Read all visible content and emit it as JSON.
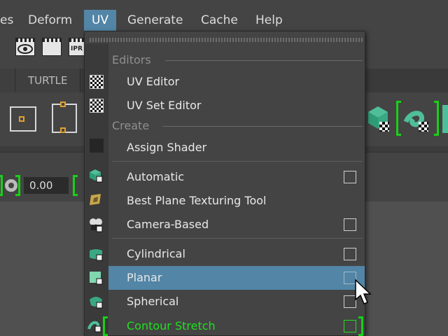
{
  "menubar": {
    "items": [
      {
        "label": "es"
      },
      {
        "label": "Deform"
      },
      {
        "label": "UV"
      },
      {
        "label": "Generate"
      },
      {
        "label": "Cache"
      },
      {
        "label": "Help"
      }
    ],
    "active": "UV"
  },
  "shelf": {
    "icons": [
      "eye-icon",
      "clapper-icon",
      "ipr-icon"
    ],
    "ipr_label": "IPR"
  },
  "tabs": {
    "turtle": "TURTLE"
  },
  "field": {
    "value": "0.00"
  },
  "menu": {
    "sections": {
      "editors": "Editors",
      "create": "Create"
    },
    "items": [
      {
        "label": "UV Editor",
        "icon": "uv-editor-icon"
      },
      {
        "label": "UV Set Editor",
        "icon": "uv-set-editor-icon"
      },
      {
        "label": "Assign Shader",
        "icon": "shader-swatch-icon"
      },
      {
        "label": "Automatic",
        "icon": "automatic-mapping-icon",
        "has_option": true
      },
      {
        "label": "Best Plane Texturing Tool",
        "icon": "best-plane-icon"
      },
      {
        "label": "Camera-Based",
        "icon": "camera-based-icon",
        "has_option": true
      },
      {
        "label": "Cylindrical",
        "icon": "cylindrical-mapping-icon",
        "has_option": true
      },
      {
        "label": "Planar",
        "icon": "planar-mapping-icon",
        "has_option": true,
        "highlighted": true
      },
      {
        "label": "Spherical",
        "icon": "spherical-mapping-icon",
        "has_option": true
      },
      {
        "label": "Contour Stretch",
        "icon": "contour-stretch-icon",
        "has_option": true,
        "favorite": true
      }
    ]
  },
  "colors": {
    "highlight": "#5285a6",
    "menu_bg": "#444444",
    "favorite_green": "#20e020",
    "section_text": "#8f8f8f"
  }
}
